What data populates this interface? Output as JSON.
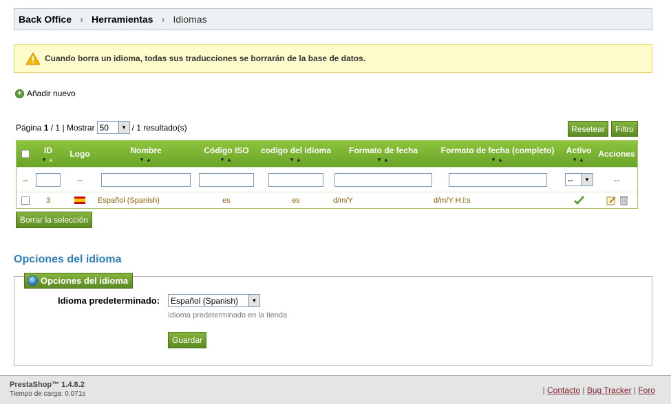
{
  "breadcrumb": {
    "items": [
      "Back Office",
      "Herramientas",
      "Idiomas"
    ]
  },
  "warning": {
    "text": "Cuando borra un idioma, todas sus traducciones se borrarán de la base de datos."
  },
  "add_new_label": "Añadir nuevo",
  "pagination": {
    "page_label": "Página",
    "current_page": "1",
    "total_pages": "/ 1",
    "show_label": "| Mostrar",
    "per_page": "50",
    "results": "/ 1 resultado(s)"
  },
  "buttons": {
    "reset": "Resetear",
    "filter": "Filtro",
    "delete_selection": "Borrar la selección",
    "save": "Guardar"
  },
  "table": {
    "columns": [
      "ID",
      "Logo",
      "Nombre",
      "Código ISO",
      "codigo del idioma",
      "Formato de fecha",
      "Formato de fecha (completo)",
      "Activo",
      "Acciones"
    ],
    "filter_placeholder": "--",
    "active_filter_value": "--",
    "rows": [
      {
        "id": "3",
        "name": "Español (Spanish)",
        "iso": "es",
        "language_code": "es",
        "date_format": "d/m/Y",
        "date_format_full": "d/m/Y H:i:s",
        "active": true
      }
    ]
  },
  "options": {
    "section_title": "Opciones del idioma",
    "legend": "Opciones del idioma",
    "default_label": "Idioma predeterminado:",
    "default_value": "Español (Spanish)",
    "hint": "Idioma predeterminado en la tienda"
  },
  "footer": {
    "version": "PrestaShop™ 1.4.8.2",
    "load_time": "Tiempo de carga: 0.071s",
    "links": [
      "Contacto",
      "Bug Tracker",
      "Foro"
    ]
  },
  "colors": {
    "header_green": "#7cb334",
    "accent_blue": "#2f7fb9",
    "warning_bg": "#fffccc"
  }
}
